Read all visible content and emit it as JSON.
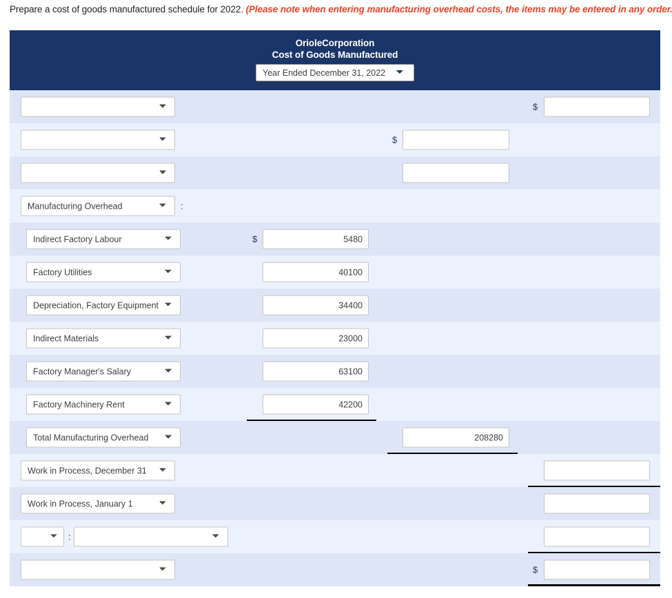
{
  "prompt": {
    "text": "Prepare a cost of goods manufactured schedule for 2022.",
    "note": "(Please note when entering manufacturing overhead costs, the items may be entered in any order.)"
  },
  "statement": {
    "company": "OrioleCorporation",
    "title": "Cost of Goods Manufactured",
    "period": "Year Ended December 31, 2022",
    "header_bg": "#1b3568",
    "row_colors": {
      "odd": "#dee5f6",
      "even": "#ebf2fd"
    },
    "currency_symbol": "$"
  },
  "rows": [
    {
      "label": "",
      "indent": 1,
      "colon": false,
      "col": "c",
      "value": "",
      "dollar": true,
      "rule": "none"
    },
    {
      "label": "",
      "indent": 1,
      "colon": false,
      "col": "b",
      "value": "",
      "dollar": true,
      "rule": "none"
    },
    {
      "label": "",
      "indent": 1,
      "colon": false,
      "col": "b",
      "value": "",
      "dollar": false,
      "rule": "none"
    },
    {
      "label": "Manufacturing Overhead",
      "indent": 1,
      "colon": true,
      "col": "none",
      "value": "",
      "dollar": false,
      "rule": "none"
    },
    {
      "label": "Indirect Factory Labour",
      "indent": 3,
      "colon": false,
      "col": "a",
      "value": "5480",
      "dollar": true,
      "rule": "none"
    },
    {
      "label": "Factory Utilities",
      "indent": 3,
      "colon": false,
      "col": "a",
      "value": "40100",
      "dollar": false,
      "rule": "none"
    },
    {
      "label": "Depreciation, Factory Equipment",
      "indent": 3,
      "colon": false,
      "col": "a",
      "value": "34400",
      "dollar": false,
      "rule": "none"
    },
    {
      "label": "Indirect Materials",
      "indent": 3,
      "colon": false,
      "col": "a",
      "value": "23000",
      "dollar": false,
      "rule": "none"
    },
    {
      "label": "Factory Manager's Salary",
      "indent": 3,
      "colon": false,
      "col": "a",
      "value": "63100",
      "dollar": false,
      "rule": "none"
    },
    {
      "label": "Factory Machinery Rent",
      "indent": 3,
      "colon": false,
      "col": "a",
      "value": "42200",
      "dollar": false,
      "rule": "under-a"
    },
    {
      "label": "Total Manufacturing Overhead",
      "indent": 3,
      "colon": false,
      "col": "b",
      "value": "208280",
      "dollar": false,
      "rule": "under-b"
    },
    {
      "label": "Work in Process, December 31",
      "indent": 1,
      "colon": false,
      "col": "c",
      "value": "",
      "dollar": false,
      "rule": "under-c"
    },
    {
      "label": "Work in Process, January 1",
      "indent": 1,
      "colon": false,
      "col": "c",
      "value": "",
      "dollar": false,
      "rule": "none"
    },
    {
      "label": "",
      "indent": 1,
      "colon": true,
      "col": "c",
      "value": "",
      "dollar": false,
      "rule": "under-c",
      "split": true,
      "label2": ""
    },
    {
      "label": "",
      "indent": 1,
      "colon": false,
      "col": "c",
      "value": "",
      "dollar": true,
      "rule": "under-c-thick"
    }
  ]
}
